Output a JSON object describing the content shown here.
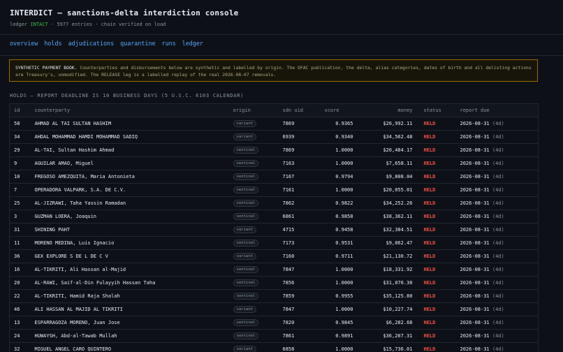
{
  "header": {
    "title": "INTERDICT — sanctions-delta interdiction console",
    "ledger_label": "ledger",
    "ledger_status": "INTACT",
    "ledger_meta": "· 5977 entries · chain verified on load"
  },
  "nav": [
    "overview",
    "holds",
    "adjudications",
    "quarantine",
    "runs",
    "ledger"
  ],
  "notice": {
    "strong": "SYNTHETIC PAYMENT BOOK.",
    "text": "Counterparties and disbursements below are synthetic and labelled by origin. The OFAC publication, the delta, alias categories, dates of birth and all delisting actions are Treasury's, unmodified. The RELEASE leg is a labelled replay of the real 2026-08-07 removals."
  },
  "section_title": "HOLDS — REPORT DEADLINE IS 10 BUSINESS DAYS (5 U.S.C. 6103 CALENDAR)",
  "table": {
    "columns": [
      "id",
      "counterparty",
      "origin",
      "sdn uid",
      "score",
      "money",
      "status",
      "report due"
    ],
    "rows": [
      {
        "id": "58",
        "counterparty": "AHMAD AL TAI SULTAN HASHIM",
        "origin": "variant",
        "sdn": "7869",
        "score": "0.9365",
        "money": "$26,992.11",
        "status": "HELD",
        "due": "2026-08-31",
        "days": "(4d)"
      },
      {
        "id": "34",
        "counterparty": "AHDAL MOHAMMAD HAMDI MOHAMMAD SADIQ",
        "origin": "variant",
        "sdn": "6939",
        "score": "0.9340",
        "money": "$34,562.48",
        "status": "HELD",
        "due": "2026-08-31",
        "days": "(4d)"
      },
      {
        "id": "29",
        "counterparty": "AL-TAI, Sultan Hashim Ahmad",
        "origin": "sentinel",
        "sdn": "7869",
        "score": "1.0000",
        "money": "$20,484.17",
        "status": "HELD",
        "due": "2026-08-31",
        "days": "(4d)"
      },
      {
        "id": "9",
        "counterparty": "AGUILAR AMAO, Miguel",
        "origin": "sentinel",
        "sdn": "7163",
        "score": "1.0000",
        "money": "$7,658.11",
        "status": "HELD",
        "due": "2026-08-31",
        "days": "(4d)"
      },
      {
        "id": "10",
        "counterparty": "FREGOSO AMEZQUITA, Maria Antonieta",
        "origin": "sentinel",
        "sdn": "7167",
        "score": "0.9794",
        "money": "$9,808.04",
        "status": "HELD",
        "due": "2026-08-31",
        "days": "(4d)"
      },
      {
        "id": "7",
        "counterparty": "OPERADORA VALPARK, S.A. DE C.V.",
        "origin": "sentinel",
        "sdn": "7161",
        "score": "1.0000",
        "money": "$20,055.01",
        "status": "HELD",
        "due": "2026-08-31",
        "days": "(4d)"
      },
      {
        "id": "25",
        "counterparty": "AL-JIZRAWI, Taha Yassin Ramadan",
        "origin": "sentinel",
        "sdn": "7862",
        "score": "0.9822",
        "money": "$34,252.26",
        "status": "HELD",
        "due": "2026-08-31",
        "days": "(4d)"
      },
      {
        "id": "3",
        "counterparty": "GUZMAN LOERA, Joaquin",
        "origin": "sentinel",
        "sdn": "6861",
        "score": "0.9858",
        "money": "$38,362.11",
        "status": "HELD",
        "due": "2026-08-31",
        "days": "(4d)"
      },
      {
        "id": "31",
        "counterparty": "SHINING PAHT",
        "origin": "variant",
        "sdn": "4715",
        "score": "0.9458",
        "money": "$32,384.51",
        "status": "HELD",
        "due": "2026-08-31",
        "days": "(4d)"
      },
      {
        "id": "11",
        "counterparty": "MORENO MEDINA, Luis Ignacio",
        "origin": "sentinel",
        "sdn": "7173",
        "score": "0.9531",
        "money": "$9,062.47",
        "status": "HELD",
        "due": "2026-08-31",
        "days": "(4d)"
      },
      {
        "id": "36",
        "counterparty": "GEX EXPLORE S DE L DE C V",
        "origin": "variant",
        "sdn": "7160",
        "score": "0.9711",
        "money": "$21,130.72",
        "status": "HELD",
        "due": "2026-08-31",
        "days": "(4d)"
      },
      {
        "id": "16",
        "counterparty": "AL-TIKRITI, Ali Hassan al-Majid",
        "origin": "sentinel",
        "sdn": "7847",
        "score": "1.0000",
        "money": "$18,331.92",
        "status": "HELD",
        "due": "2026-08-31",
        "days": "(4d)"
      },
      {
        "id": "20",
        "counterparty": "AL-RAWI, Saif-al-Din Fulayyih Hassan Taha",
        "origin": "sentinel",
        "sdn": "7856",
        "score": "1.0000",
        "money": "$31,070.30",
        "status": "HELD",
        "due": "2026-08-31",
        "days": "(4d)"
      },
      {
        "id": "22",
        "counterparty": "AL-TIKRITI, Hamid Raja Shalah",
        "origin": "sentinel",
        "sdn": "7859",
        "score": "0.9955",
        "money": "$35,125.80",
        "status": "HELD",
        "due": "2026-08-31",
        "days": "(4d)"
      },
      {
        "id": "46",
        "counterparty": "ALI HASSAN AL MAJID AL TIKRITI",
        "origin": "variant",
        "sdn": "7847",
        "score": "1.0000",
        "money": "$10,227.74",
        "status": "HELD",
        "due": "2026-08-31",
        "days": "(4d)"
      },
      {
        "id": "13",
        "counterparty": "ESPARRAGOZA MORENO, Juan Jose",
        "origin": "sentinel",
        "sdn": "7820",
        "score": "0.9845",
        "money": "$6,282.68",
        "status": "HELD",
        "due": "2026-08-31",
        "days": "(4d)"
      },
      {
        "id": "24",
        "counterparty": "HUWAYSH, Abd-al-Tawab Mullah",
        "origin": "sentinel",
        "sdn": "7861",
        "score": "0.9891",
        "money": "$36,207.31",
        "status": "HELD",
        "due": "2026-08-31",
        "days": "(4d)"
      },
      {
        "id": "32",
        "counterparty": "MIGUEL ANGEL CARO QUINTERO",
        "origin": "variant",
        "sdn": "6858",
        "score": "1.0000",
        "money": "$15,736.01",
        "status": "HELD",
        "due": "2026-08-31",
        "days": "(4d)"
      }
    ]
  }
}
